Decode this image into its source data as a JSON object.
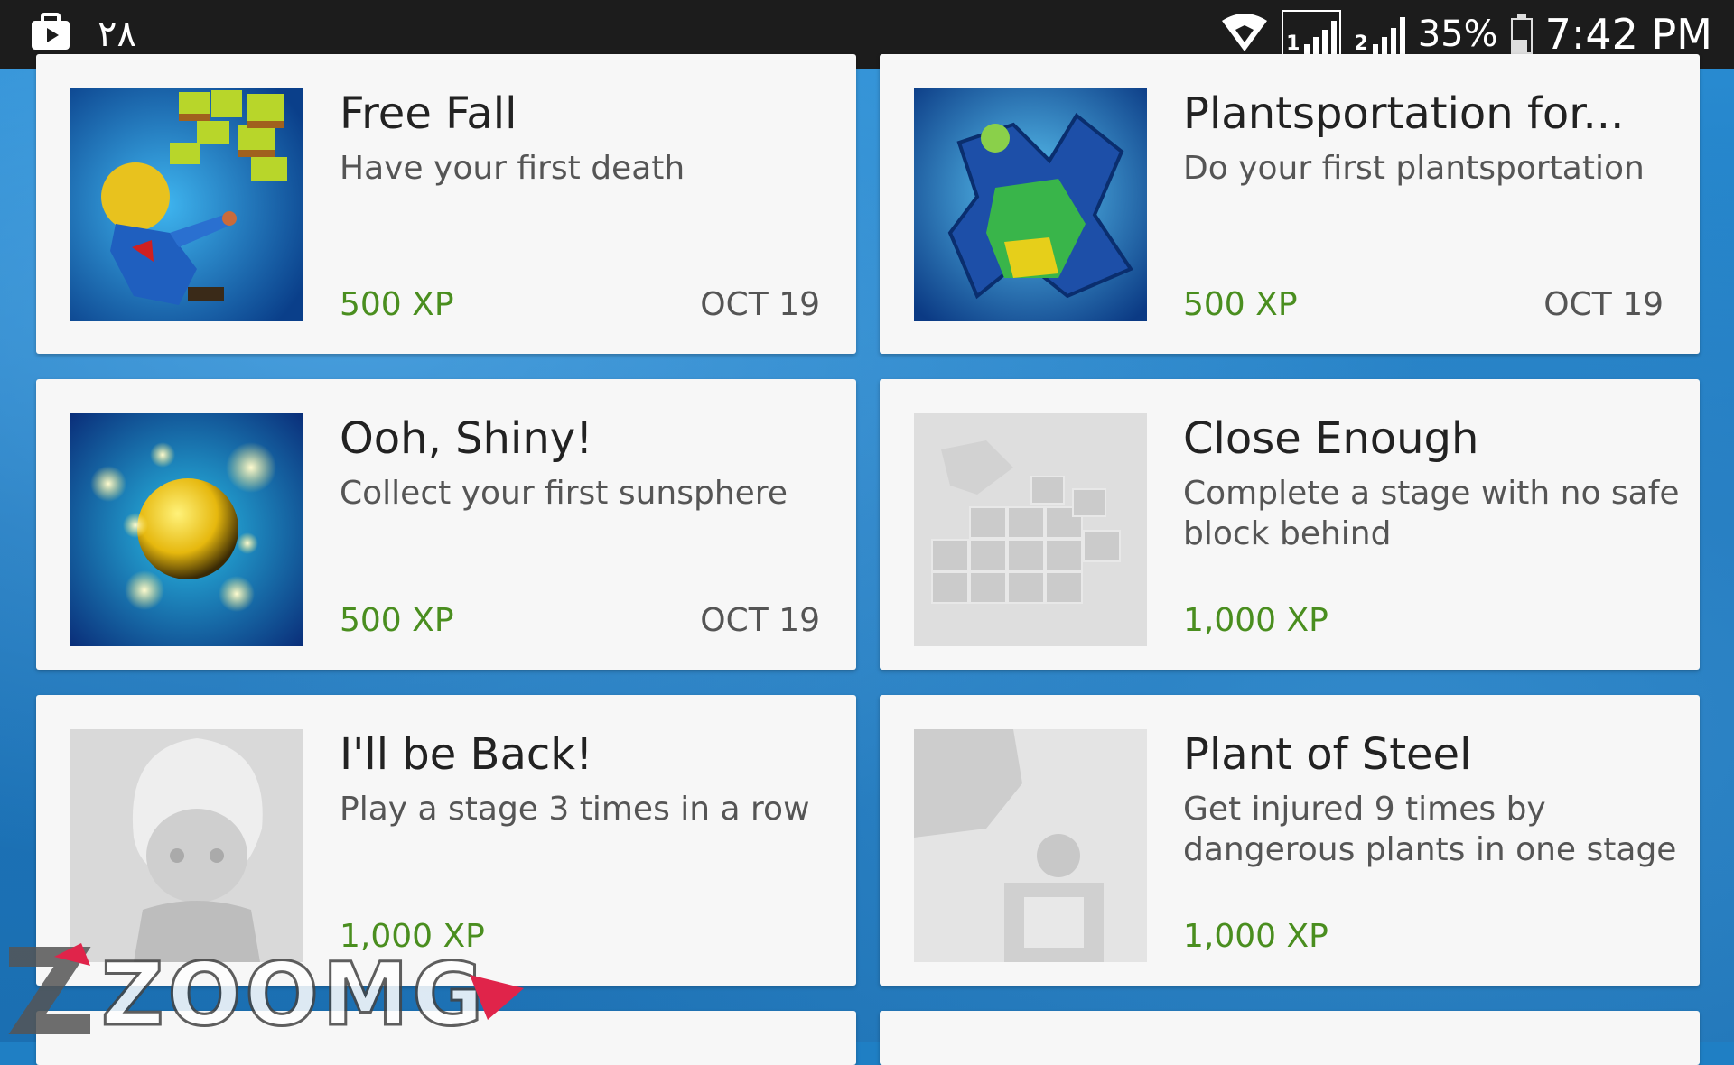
{
  "status_bar": {
    "left_text": "٢٨",
    "battery_percent": "35%",
    "time": "7:42 PM",
    "sim1_label": "1",
    "sim2_label": "2"
  },
  "colors": {
    "xp": "#4a8e1f",
    "background": "#1f7fc4"
  },
  "achievements": [
    {
      "title": "Free Fall",
      "description": "Have your first death",
      "xp": "500 XP",
      "date": "OCT 19",
      "unlocked": true,
      "icon": "falling-character-icon"
    },
    {
      "title": "Plantsportation for...",
      "description": "Do your first plantsportation",
      "xp": "500 XP",
      "date": "OCT 19",
      "unlocked": true,
      "icon": "plant-creature-icon"
    },
    {
      "title": "Ooh, Shiny!",
      "description": "Collect your first sunsphere",
      "xp": "500 XP",
      "date": "OCT 19",
      "unlocked": true,
      "icon": "sunsphere-icon"
    },
    {
      "title": "Close Enough",
      "description": "Complete a stage with no safe block behind",
      "xp": "1,000 XP",
      "date": "",
      "unlocked": false,
      "icon": "blocks-icon"
    },
    {
      "title": "I'll be Back!",
      "description": "Play a stage 3 times in a row",
      "xp": "1,000 XP",
      "date": "",
      "unlocked": false,
      "icon": "character-portrait-icon"
    },
    {
      "title": "Plant of Steel",
      "description": "Get injured 9 times by dangerous plants in one stage",
      "xp": "1,000 XP",
      "date": "",
      "unlocked": false,
      "icon": "dangerous-plant-icon"
    }
  ],
  "watermark_text": "ZOOMG"
}
